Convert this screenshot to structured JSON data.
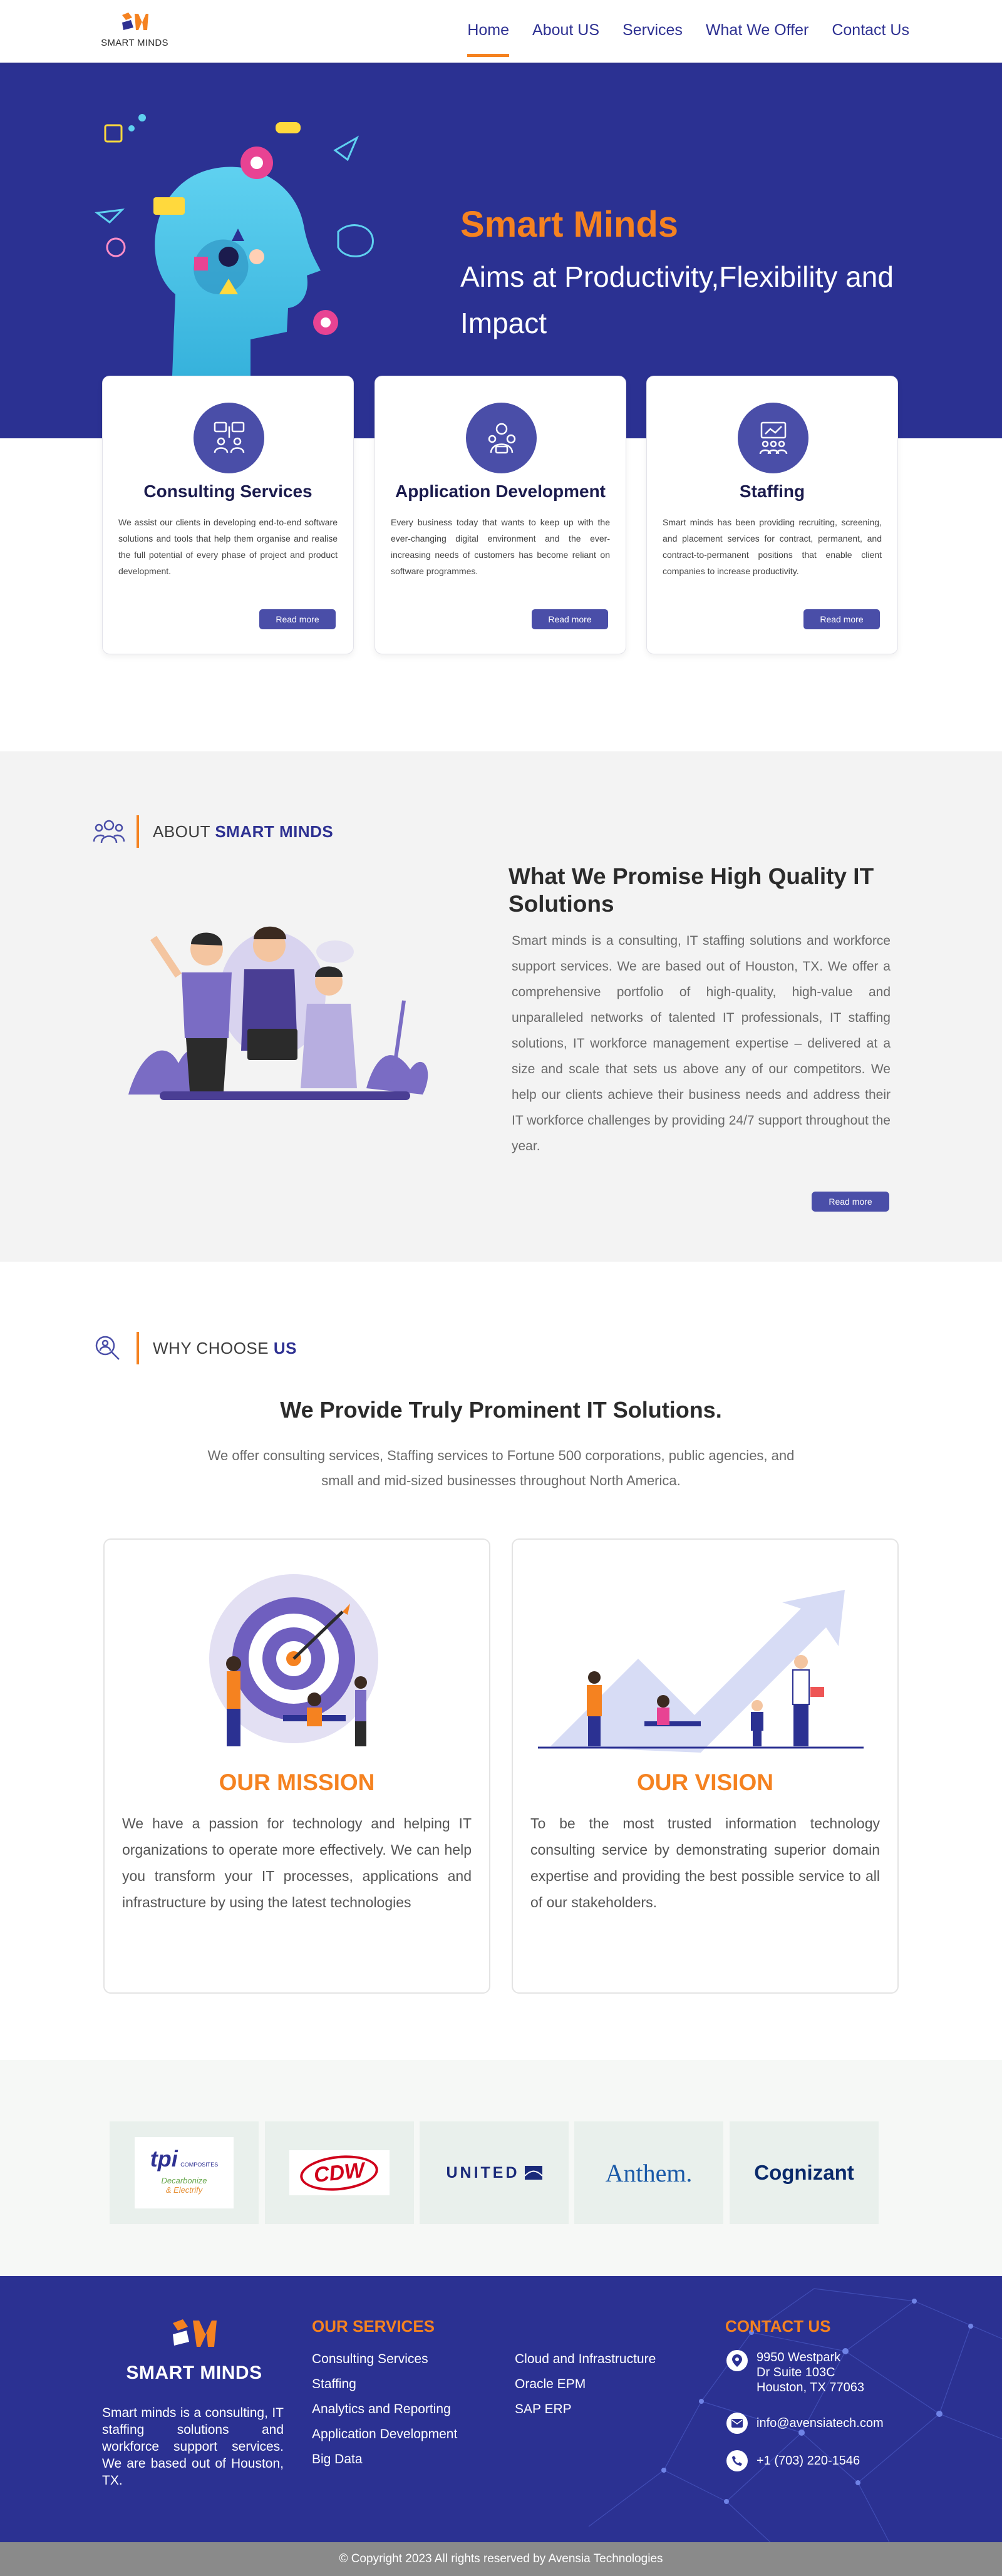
{
  "nav": {
    "logo_text": "SMART MINDS",
    "items": [
      {
        "label": "Home"
      },
      {
        "label": "About US"
      },
      {
        "label": "Services"
      },
      {
        "label": "What  We Offer"
      },
      {
        "label": "Contact Us"
      }
    ]
  },
  "hero": {
    "title": "Smart Minds",
    "subtitle": "Aims at Productivity,Flexibility and Impact"
  },
  "services": [
    {
      "title": "Consulting Services",
      "text": "We assist our clients in developing end-to-end software solutions and tools that help them organise and realise the full potential of every phase of project and product development.",
      "button": "Read more",
      "icon": "people-network-icon"
    },
    {
      "title": "Application Development",
      "text": "Every business today that wants to keep up with the ever-changing digital environment and the ever-increasing needs of customers has become reliant on software programmes.",
      "button": "Read more",
      "icon": "developer-gear-icon"
    },
    {
      "title": "Staffing",
      "text": "Smart minds has been providing recruiting, screening, and placement services for contract, permanent, and contract-to-permanent positions that enable client companies to increase productivity.",
      "button": "Read more",
      "icon": "presentation-team-icon"
    }
  ],
  "about": {
    "tag_prefix": "ABOUT",
    "tag_highlight": "SMART MINDS",
    "heading": "What We Promise High Quality IT Solutions",
    "body": "Smart minds is a consulting, IT staffing solutions and workforce support services. We are based out of Houston, TX. We offer a comprehensive portfolio of high-quality, high-value and unparalleled networks of talented IT professionals, IT staffing solutions, IT workforce management expertise – delivered at a size and scale that sets us above any of our competitors. We help our clients achieve their business needs and address their IT workforce challenges by providing 24/7 support throughout the year.",
    "button": "Read more"
  },
  "why": {
    "tag_prefix": "WHY CHOOSE",
    "tag_highlight": "US",
    "heading": "We Provide Truly Prominent IT Solutions.",
    "body": "We offer consulting services, Staffing services to Fortune 500 corporations, public agencies, and small and mid-sized businesses throughout North America.",
    "mission": {
      "title": "OUR MISSION",
      "text": "We have a passion for technology and helping IT organizations to operate more effectively. We can help you transform your IT processes, applications and infrastructure by using the latest technologies"
    },
    "vision": {
      "title": "OUR VISION",
      "text": "To be the most trusted information technology consulting service by demonstrating superior domain expertise and providing the best possible service to all of our stakeholders."
    }
  },
  "clients": {
    "tpi_name": "tpi",
    "tpi_sub": "COMPOSITES",
    "tpi_tag1": "Decarbonize",
    "tpi_tag2": "& Electrify",
    "cdw": "CDW",
    "united": "UNITED",
    "anthem": "Anthem.",
    "cognizant": "Cognizant"
  },
  "footer": {
    "brand": "SMART MINDS",
    "about": "Smart minds is a consulting, IT staffing solutions and workforce support services. We are based out of Houston, TX.",
    "services_heading": "OUR SERVICES",
    "services_col1": [
      "Consulting Services",
      "Staffing",
      "Analytics and Reporting",
      "Application Development",
      "Big Data"
    ],
    "services_col2": [
      "Cloud and Infrastructure",
      "Oracle EPM",
      "SAP ERP"
    ],
    "contact_heading": "CONTACT US",
    "address_line1": "9950 Westpark",
    "address_line2": "Dr Suite 103C",
    "address_line3": "Houston, TX 77063",
    "email": "info@avensiatech.com",
    "phone": "+1 (703) 220-1546",
    "copyright": "© Copyright 2023 All rights reserved by Avensia Technologies"
  },
  "colors": {
    "primary": "#2b3192",
    "accent": "#f58220",
    "button": "#4a4ea8"
  }
}
